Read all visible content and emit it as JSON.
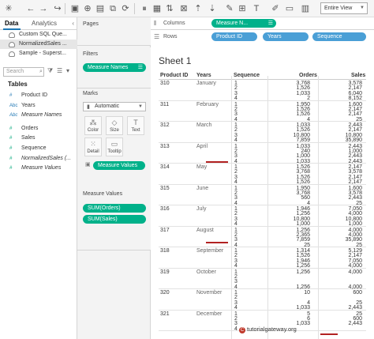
{
  "toolbar": {
    "fit_select": "Entire View"
  },
  "data_pane": {
    "tab_data": "Data",
    "tab_analytics": "Analytics",
    "data_sources": [
      {
        "label": "Custom SQL Que...",
        "selected": false
      },
      {
        "label": "NormalizedSales ...",
        "selected": true
      },
      {
        "label": "Sample - Superst...",
        "selected": false
      }
    ],
    "search_placeholder": "Search",
    "tables_header": "Tables",
    "fields": [
      {
        "type": "#",
        "label": "Product ID",
        "italic": false,
        "kind": "dim"
      },
      {
        "type": "Abc",
        "label": "Years",
        "italic": false,
        "kind": "dim"
      },
      {
        "type": "Abc",
        "label": "Measure Names",
        "italic": true,
        "kind": "dim"
      },
      {
        "type": "#",
        "label": "Orders",
        "italic": false,
        "kind": "meas"
      },
      {
        "type": "#",
        "label": "Sales",
        "italic": false,
        "kind": "meas"
      },
      {
        "type": "#",
        "label": "Sequence",
        "italic": false,
        "kind": "meas"
      },
      {
        "type": "#",
        "label": "NormalizedSales (...",
        "italic": true,
        "kind": "meas"
      },
      {
        "type": "#",
        "label": "Measure Values",
        "italic": true,
        "kind": "meas"
      }
    ]
  },
  "shelves": {
    "pages_title": "Pages",
    "filters_title": "Filters",
    "filter_pill": "Measure Names",
    "marks_title": "Marks",
    "mark_type": "Automatic",
    "mark_buttons": [
      "Color",
      "Size",
      "Text",
      "Detail",
      "Tooltip"
    ],
    "marks_pill": "Measure Values",
    "measure_values_title": "Measure Values",
    "measure_value_pills": [
      "SUM(Orders)",
      "SUM(Sales)"
    ]
  },
  "columns_shelf": {
    "label": "Columns",
    "pills": [
      "Measure N..."
    ]
  },
  "rows_shelf": {
    "label": "Rows",
    "pills": [
      "Product ID",
      "Years",
      "Sequence"
    ]
  },
  "view": {
    "sheet_title": "Sheet 1",
    "headers": {
      "product_id": "Product ID",
      "years": "Years",
      "sequence": "Sequence",
      "orders": "Orders",
      "sales": "Sales"
    },
    "rows": [
      {
        "pid": "310",
        "year": "January",
        "orders": [
          "3,768",
          "1,526",
          "1,033",
          "2"
        ],
        "sales": [
          "3,578",
          "2,147",
          "6,040",
          "8,152"
        ]
      },
      {
        "pid": "311",
        "year": "February",
        "orders": [
          "1,950",
          "1,526",
          "1,526",
          "4"
        ],
        "sales": [
          "1,600",
          "2,147",
          "2,147",
          "25"
        ]
      },
      {
        "pid": "312",
        "year": "March",
        "orders": [
          "1,033",
          "1,526",
          "10,800",
          "7,859"
        ],
        "sales": [
          "2,443",
          "2,147",
          "10,800",
          "35,890"
        ]
      },
      {
        "pid": "313",
        "year": "April",
        "orders": [
          "1,033",
          "240",
          "1,000",
          "1,033"
        ],
        "sales": [
          "2,443",
          "1,000",
          "2,443",
          "2,443"
        ]
      },
      {
        "pid": "314",
        "year": "May",
        "orders": [
          "1,526",
          "3,768",
          "1,526",
          "1,526"
        ],
        "sales": [
          "2,147",
          "3,578",
          "2,147",
          "2,147"
        ]
      },
      {
        "pid": "315",
        "year": "June",
        "orders": [
          "1,950",
          "3,768",
          "560",
          "4"
        ],
        "sales": [
          "1,600",
          "3,578",
          "2,443",
          "25"
        ]
      },
      {
        "pid": "316",
        "year": "July",
        "orders": [
          "1,946",
          "1,256",
          "10,800",
          "1,000"
        ],
        "sales": [
          "7,050",
          "4,000",
          "10,800",
          "1,000"
        ]
      },
      {
        "pid": "317",
        "year": "August",
        "orders": [
          "1,256",
          "2,365",
          "7,859",
          "25"
        ],
        "sales": [
          "4,000",
          "4,000",
          "35,890",
          "25"
        ]
      },
      {
        "pid": "318",
        "year": "September",
        "orders": [
          "1,314",
          "1,526",
          "1,946",
          "1,256"
        ],
        "sales": [
          "5,129",
          "2,147",
          "7,050",
          "4,000"
        ]
      },
      {
        "pid": "319",
        "year": "October",
        "orders": [
          "1,256",
          "",
          "",
          "1,256"
        ],
        "sales": [
          "4,000",
          "",
          "",
          "4,000"
        ]
      },
      {
        "pid": "320",
        "year": "November",
        "orders": [
          "10",
          "",
          "4",
          "1,033"
        ],
        "sales": [
          "600",
          "",
          "25",
          "2,443"
        ]
      },
      {
        "pid": "321",
        "year": "December",
        "orders": [
          "5",
          "6",
          "1,033",
          ""
        ],
        "sales": [
          "25",
          "600",
          "2,443",
          ""
        ]
      }
    ],
    "watermark": "tutorialgateway.org",
    "watermark_mark": "C"
  }
}
